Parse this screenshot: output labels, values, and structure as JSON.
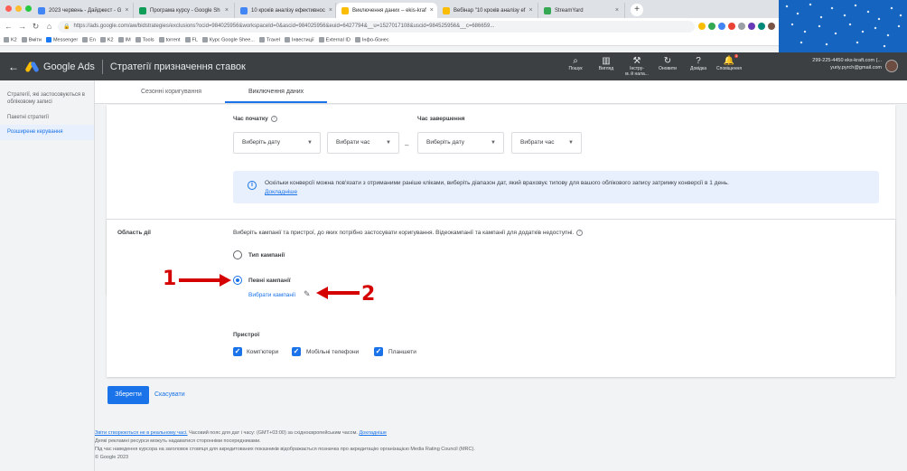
{
  "browser": {
    "tabs": [
      {
        "title": "2023 червень - Дайджест - G",
        "color": "#4285f4"
      },
      {
        "title": "Програма курсу - Google Sh",
        "color": "#0f9d58"
      },
      {
        "title": "10 кроків аналізу ефективнос",
        "color": "#4285f4"
      },
      {
        "title": "Виключення даних – ekis-kraf",
        "color": "#fbbc04"
      },
      {
        "title": "Вебінар \"10 кроків аналізу ef",
        "color": "#fbbc04"
      },
      {
        "title": "StreamYard",
        "color": "#34a853"
      }
    ],
    "url": "https://ads.google.com/aw/bidstrategies/exclusions?ocid=984025956&workspaceId=0&ascid=984025956&euid=6427794&__u=1527017108&uscid=984525956&__c=686659..."
  },
  "bookmarks": [
    "K2",
    "Вміти",
    "Messenger",
    "En",
    "K2",
    "IM",
    "Tools",
    "torrent",
    "FL",
    "Курс Google Shee...",
    "Travel",
    "Інвестиції",
    "External ID",
    "Інфо-бізнес"
  ],
  "header": {
    "product": "Google Ads",
    "page_title": "Стратегії призначення ставок",
    "actions": [
      {
        "icon": "⌕",
        "label": "Пошук",
        "name": "search"
      },
      {
        "icon": "▥",
        "label": "Вигляд",
        "name": "appearance"
      },
      {
        "icon": "⚒",
        "label": "Інстру-\nм. й нала...",
        "name": "tools"
      },
      {
        "icon": "↻",
        "label": "Оновити",
        "name": "refresh"
      },
      {
        "icon": "?",
        "label": "Довідка",
        "name": "help"
      },
      {
        "icon": "♪",
        "label": "Сповіщення",
        "name": "notifications"
      }
    ],
    "notification_count": "1",
    "account_id": "299-225-4450 eks-kraft.com (...",
    "account_email": "yuriy.pyrch@gmail.com"
  },
  "sidebar": {
    "items": [
      {
        "label": "Стратегії, які застосовуються в обліковому записі",
        "active": false
      },
      {
        "label": "Пакетні стратегії",
        "active": false
      },
      {
        "label": "Розширене керування",
        "active": true
      }
    ]
  },
  "subtabs": [
    {
      "label": "Сезонні коригування",
      "active": false
    },
    {
      "label": "Виключення даних",
      "active": true
    }
  ],
  "time": {
    "start_label": "Час початку",
    "end_label": "Час завершення",
    "start_date": "Виберіть дату",
    "start_time": "Вибрати час",
    "end_date": "Виберіть дату",
    "end_time": "Вибрати час",
    "separator": "–"
  },
  "info": {
    "text": "Оскільки конверсії можна пов'язати з отриманими раніше кліками, виберіть діапазон дат, який враховує типову для вашого облікового запису затримку конверсії в 1 день.",
    "link": "Докладніше"
  },
  "scope": {
    "label": "Область дії",
    "description": "Виберіть кампанії та пристрої, до яких потрібно застосувати коригування. Відеокампанії та кампанії для додатків недоступні.",
    "options": [
      {
        "label": "Тип кампанії",
        "selected": false
      },
      {
        "label": "Певні кампанії",
        "selected": true
      }
    ],
    "select_link": "Вибрати кампанії"
  },
  "devices": {
    "label": "Пристрої",
    "items": [
      {
        "label": "Комп'ютери",
        "checked": true
      },
      {
        "label": "Мобільні телефони",
        "checked": true
      },
      {
        "label": "Планшети",
        "checked": true
      }
    ]
  },
  "buttons": {
    "save": "Зберегти",
    "cancel": "Скасувати"
  },
  "footer": {
    "line1_link": "Звіти створюються не в реальному часі.",
    "line1_text": "Часовий пояс для дат і часу: (GMT+03:00) за східноєвропейським часом.",
    "line1_link2": "Докладніше",
    "line2": "Деякі рекламні ресурси можуть надаватися сторонніми посередниками.",
    "line3": "Під час наведення курсора на заголовок стовпця для акредитованих показників відображається позначка про акредитацію організацією Media Rating Council (MRC).",
    "line4": "© Google 2023"
  },
  "annotations": {
    "first": "1",
    "second": "2",
    "color": "#d50000"
  }
}
